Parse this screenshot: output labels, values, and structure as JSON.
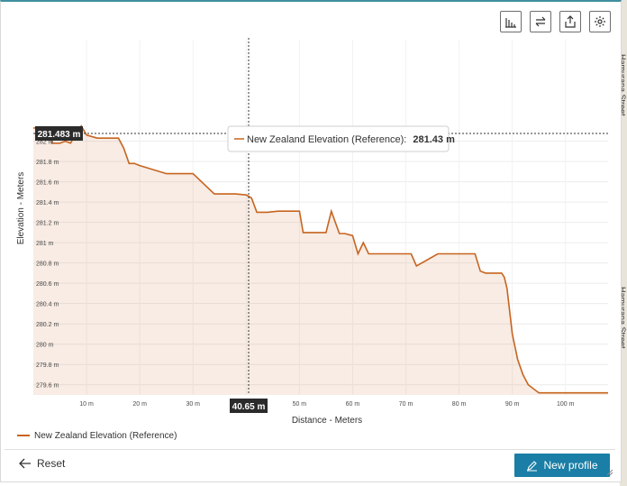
{
  "toolbar": {
    "icons": [
      "bar-chart-icon",
      "swap-icon",
      "export-icon",
      "settings-icon"
    ]
  },
  "map": {
    "street_top": "Hamurana Street",
    "street_bottom": "Hamurana Street"
  },
  "cursor": {
    "distance_label": "40.65 m",
    "elevation_label": "281.483 m",
    "tooltip_series": "New Zealand Elevation (Reference):",
    "tooltip_value": "281.43 m"
  },
  "chart_data": {
    "type": "area",
    "xlabel": "Distance - Meters",
    "ylabel": "Elevation - Meters",
    "xlim": [
      0,
      108
    ],
    "ylim": [
      279.5,
      283
    ],
    "x_ticks": [
      10,
      20,
      30,
      40,
      50,
      60,
      70,
      80,
      90,
      100
    ],
    "x_tick_labels": [
      "10 m",
      "20 m",
      "30 m",
      "40 m",
      "50 m",
      "60 m",
      "70 m",
      "80 m",
      "90 m",
      "100 m"
    ],
    "y_ticks": [
      279.6,
      279.8,
      280,
      280.2,
      280.4,
      280.6,
      280.8,
      281,
      281.2,
      281.4,
      281.6,
      281.8,
      282
    ],
    "y_tick_labels": [
      "279.6 m",
      "279.8 m",
      "280 m",
      "280.2 m",
      "280.4 m",
      "280.6 m",
      "280.8 m",
      "281 m",
      "281.2 m",
      "281.4 m",
      "281.6 m",
      "281.8 m",
      "282 m"
    ],
    "grid": true,
    "series": [
      {
        "name": "New Zealand Elevation (Reference)",
        "color": "#c7641f",
        "x": [
          0,
          2.5,
          3.5,
          5,
          6,
          7,
          8,
          9,
          10,
          12,
          15,
          16,
          17,
          18,
          19,
          20,
          25,
          29,
          30,
          34,
          38,
          40,
          41,
          42,
          44,
          46,
          50,
          50.7,
          55,
          56,
          57.5,
          58.5,
          60,
          61,
          62,
          63,
          65,
          67,
          68,
          71,
          72,
          76,
          83,
          84,
          85,
          87,
          88,
          88.5,
          89,
          90,
          91,
          92,
          93,
          95,
          108
        ],
        "y": [
          282.13,
          282.13,
          281.98,
          281.98,
          282,
          281.98,
          282.08,
          282.15,
          282.06,
          282.03,
          282.03,
          282.03,
          281.93,
          281.78,
          281.78,
          281.76,
          281.68,
          281.68,
          281.68,
          281.48,
          281.48,
          281.47,
          281.44,
          281.3,
          281.3,
          281.31,
          281.31,
          281.1,
          281.1,
          281.31,
          281.09,
          281.09,
          281.07,
          280.89,
          281,
          280.89,
          280.89,
          280.89,
          280.89,
          280.89,
          280.77,
          280.89,
          280.89,
          280.72,
          280.7,
          280.7,
          280.7,
          280.66,
          280.55,
          280.1,
          279.85,
          279.7,
          279.6,
          279.52,
          279.52
        ]
      }
    ]
  },
  "legend": {
    "label": "New Zealand Elevation (Reference)"
  },
  "footer": {
    "reset_label": "Reset",
    "new_profile_label": "New profile"
  }
}
